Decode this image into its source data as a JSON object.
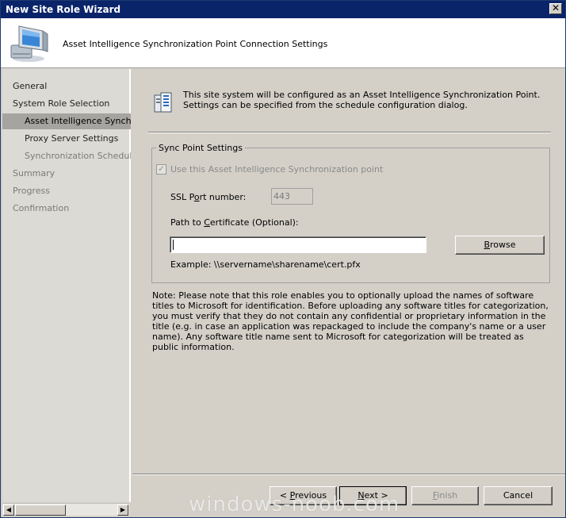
{
  "window": {
    "title": "New Site Role Wizard",
    "close_glyph": "✕"
  },
  "header": {
    "heading": "Asset Intelligence Synchronization Point Connection Settings",
    "icon": "computer-icon"
  },
  "nav": {
    "items": [
      {
        "label": "General",
        "state": "normal"
      },
      {
        "label": "System Role Selection",
        "state": "normal"
      },
      {
        "label": "Asset Intelligence Synchronization Point",
        "state": "selected"
      },
      {
        "label": "Proxy Server Settings",
        "state": "normal"
      },
      {
        "label": "Synchronization Schedule",
        "state": "dim"
      },
      {
        "label": "Summary",
        "state": "dim"
      },
      {
        "label": "Progress",
        "state": "dim"
      },
      {
        "label": "Confirmation",
        "state": "dim"
      }
    ]
  },
  "main": {
    "info_text": "This site system will be configured as an Asset Intelligence Synchronization Point. Settings can be specified from the schedule configuration dialog.",
    "group_title": "Sync Point Settings",
    "use_checkbox": {
      "label": "Use this Asset Intelligence Synchronization point",
      "checked": true,
      "enabled": false
    },
    "ssl_label": "SSL Port number:",
    "ssl_value": "443",
    "cert_label": "Path to Certificate (Optional):",
    "cert_value": "",
    "browse_label": "Browse",
    "example": "Example: \\\\servername\\sharename\\cert.pfx",
    "note": "Note: Please note that this role enables you to optionally upload the names of software titles to Microsoft for identification. Before uploading any software titles for categorization, you must verify that they do not contain any confidential or proprietary information in the title (e.g. in case an application was repackaged to include the company's name or a user name). Any software title name sent to Microsoft for categorization will be treated as public information."
  },
  "buttons": {
    "previous": "< Previous",
    "next": "Next >",
    "finish": "Finish",
    "cancel": "Cancel"
  },
  "watermark": "windows-noob.com"
}
